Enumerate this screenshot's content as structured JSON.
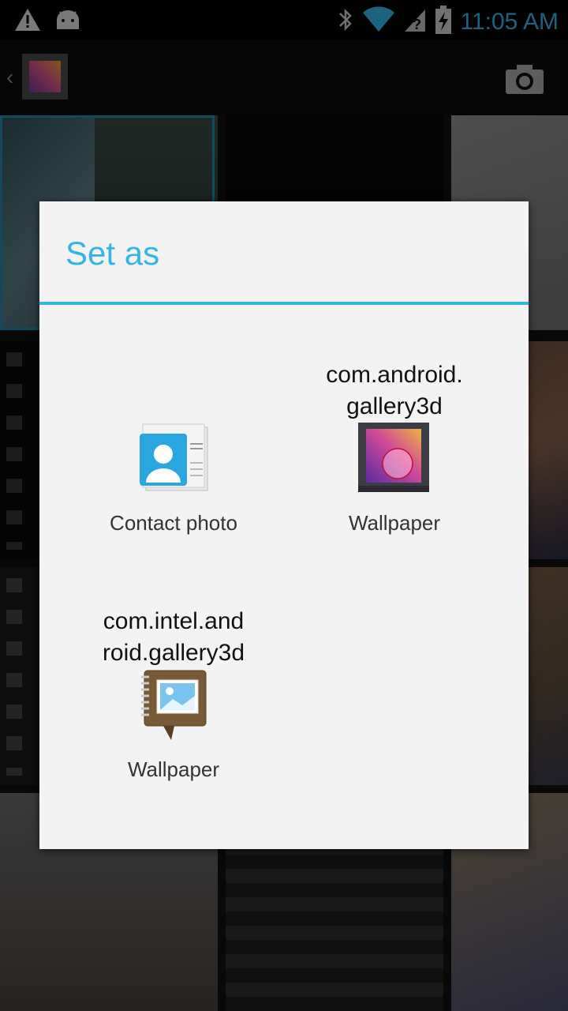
{
  "status_bar": {
    "time": "11:05 AM",
    "icons": [
      "warning-icon",
      "android-icon",
      "bluetooth-icon",
      "wifi-icon",
      "signal-unknown-icon",
      "battery-charging-icon"
    ]
  },
  "action_bar": {
    "icons": [
      "up-chevron-icon",
      "gallery-app-icon",
      "camera-icon"
    ]
  },
  "dialog": {
    "title": "Set as",
    "options": [
      {
        "package": "",
        "label": "Contact photo",
        "icon": "contacts-icon"
      },
      {
        "package": "com.android.\ngallery3d",
        "label": "Wallpaper",
        "icon": "gallery-icon"
      },
      {
        "package": "com.intel.and\nroid.gallery3d",
        "label": "Wallpaper",
        "icon": "photo-album-icon"
      }
    ]
  },
  "colors": {
    "accent": "#33b5e5",
    "dialog_bg": "#f3f3f3",
    "status_bar_bg": "#000000"
  }
}
